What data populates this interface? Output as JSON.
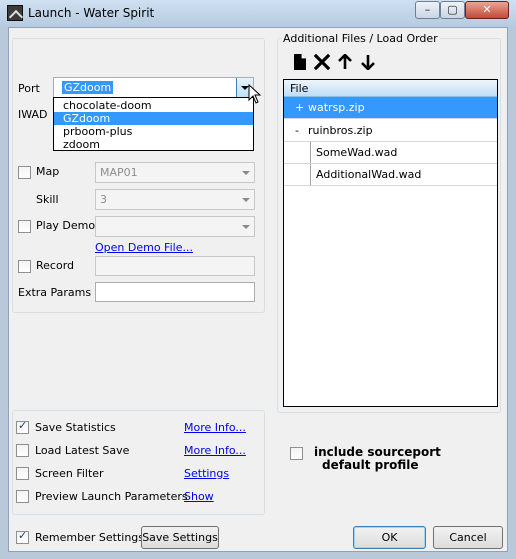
{
  "window": {
    "title": "Launch - Water Spirit",
    "min_glyph": "–",
    "max_glyph": "▢",
    "close_glyph": "✕"
  },
  "port": {
    "label": "Port",
    "value": "GZdoom",
    "options": [
      "chocolate-doom",
      "GZdoom",
      "prboom-plus",
      "zdoom"
    ],
    "selected_index": 1
  },
  "iwad": {
    "label": "IWAD"
  },
  "map": {
    "label": "Map",
    "value": "MAP01",
    "checked": false
  },
  "skill": {
    "label": "Skill",
    "value": "3"
  },
  "play_demo": {
    "label": "Play Demo",
    "value": "",
    "open_link": "Open Demo File...",
    "checked": false
  },
  "record": {
    "label": "Record",
    "checked": false
  },
  "extra_params": {
    "label": "Extra Params",
    "value": ""
  },
  "options": [
    {
      "label": "Save Statistics",
      "checked": true,
      "link": "More Info..."
    },
    {
      "label": "Load Latest Save",
      "checked": false,
      "link": "More Info..."
    },
    {
      "label": "Screen Filter",
      "checked": false,
      "link": "Settings"
    },
    {
      "label": "Preview Launch Parameters",
      "checked": false,
      "link": "Show"
    }
  ],
  "files": {
    "group_label": "Additional Files / Load Order",
    "column_header": "File",
    "rows": [
      {
        "expander": "+",
        "name": "watrsp.zip",
        "selected": true
      },
      {
        "expander": "-",
        "name": "ruinbros.zip",
        "selected": false
      },
      {
        "expander": "",
        "name": "SomeWad.wad",
        "selected": false
      },
      {
        "expander": "",
        "name": "AdditionalWad.wad",
        "selected": false
      }
    ]
  },
  "include_profile": {
    "label_line1": "include sourceport",
    "label_line2": "default profile",
    "checked": false
  },
  "footer": {
    "remember_label": "Remember Settings",
    "remember_checked": true,
    "save_settings": "Save Settings",
    "ok": "OK",
    "cancel": "Cancel"
  },
  "colors": {
    "selection": "#3399ff",
    "link": "#0000ee",
    "titlebar": "#b9c9da"
  }
}
